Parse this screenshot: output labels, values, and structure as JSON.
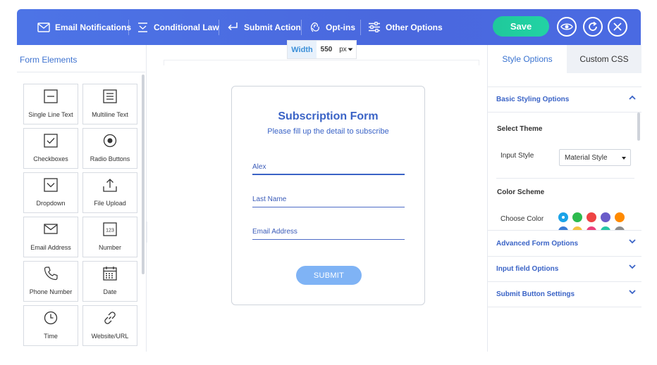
{
  "topbar": {
    "menu": [
      {
        "label": "Email Notifications",
        "icon": "envelope-icon"
      },
      {
        "label": "Conditional Law",
        "icon": "conditional-icon"
      },
      {
        "label": "Submit Action",
        "icon": "submit-arrow-icon"
      },
      {
        "label": "Opt-ins",
        "icon": "opt-in-icon"
      },
      {
        "label": "Other Options",
        "icon": "sliders-icon"
      }
    ],
    "save_label": "Save"
  },
  "left_panel": {
    "title": "Form Elements",
    "elements": [
      {
        "label": "Single Line Text",
        "icon": "single-line-icon"
      },
      {
        "label": "Multiline Text",
        "icon": "multiline-icon"
      },
      {
        "label": "Checkboxes",
        "icon": "checkbox-icon"
      },
      {
        "label": "Radio Buttons",
        "icon": "radio-icon"
      },
      {
        "label": "Dropdown",
        "icon": "dropdown-icon"
      },
      {
        "label": "File Upload",
        "icon": "upload-icon"
      },
      {
        "label": "Email Address",
        "icon": "email-icon"
      },
      {
        "label": "Number",
        "icon": "number-icon"
      },
      {
        "label": "Phone Number",
        "icon": "phone-icon"
      },
      {
        "label": "Date",
        "icon": "calendar-icon"
      },
      {
        "label": "Time",
        "icon": "clock-icon"
      },
      {
        "label": "Website/URL",
        "icon": "link-icon"
      }
    ],
    "number_icon_text": "123"
  },
  "canvas": {
    "width_label": "Width",
    "width_value": "550",
    "width_unit": "px"
  },
  "form": {
    "title": "Subscription Form",
    "subtitle": "Please fill up the detail to subscribe",
    "fields": [
      "Alex",
      "Last Name",
      "Email Address"
    ],
    "submit_label": "SUBMIT"
  },
  "right_panel": {
    "tabs": [
      "Style Options",
      "Custom CSS"
    ],
    "sections": {
      "basic": "Basic Styling Options",
      "advanced": "Advanced Form Options",
      "input_field": "Input field Options",
      "submit_button": "Submit Button Settings"
    },
    "select_theme_title": "Select Theme",
    "input_style_label": "Input Style",
    "input_style_value": "Material Style",
    "color_scheme_title": "Color Scheme",
    "choose_color_label": "Choose Color",
    "colors_row1": [
      "#1aa3e8",
      "#2dbb4e",
      "#ee4444",
      "#6a5cc9",
      "#ff8a00"
    ],
    "colors_row2": [
      "#3a7bd5",
      "#f5c242",
      "#ec407a",
      "#26c6a6",
      "#8c8c8c"
    ]
  }
}
